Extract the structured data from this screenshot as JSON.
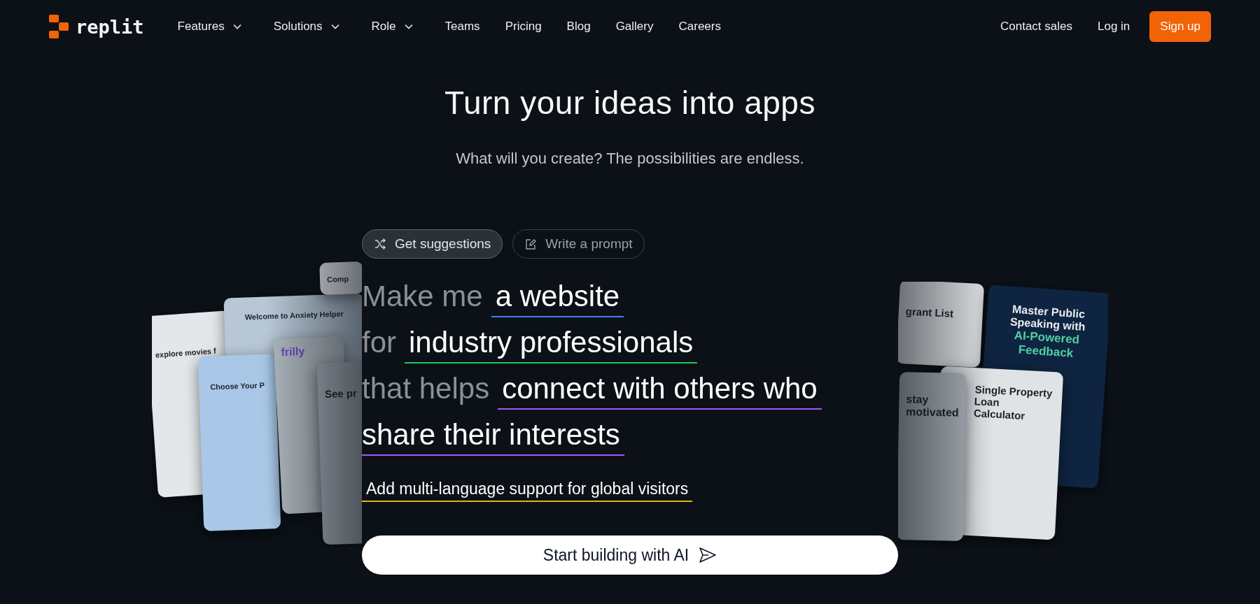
{
  "nav": {
    "logo": "replit",
    "items": [
      {
        "label": "Features",
        "menu": true
      },
      {
        "label": "Solutions",
        "menu": true
      },
      {
        "label": "Role",
        "menu": true
      },
      {
        "label": "Teams",
        "menu": false
      },
      {
        "label": "Pricing",
        "menu": false
      },
      {
        "label": "Blog",
        "menu": false
      },
      {
        "label": "Gallery",
        "menu": false
      },
      {
        "label": "Careers",
        "menu": false
      }
    ],
    "actions": [
      {
        "label": "Contact sales",
        "kind": "link"
      },
      {
        "label": "Log in",
        "kind": "link"
      },
      {
        "label": "Sign up",
        "kind": "primary"
      }
    ]
  },
  "hero": {
    "title": "Turn your ideas into apps",
    "subtitle": "What will you create? The possibilities are endless."
  },
  "modes": [
    {
      "label": "Get suggestions",
      "selected": true
    },
    {
      "label": "Write a prompt",
      "selected": false
    }
  ],
  "prompt_lines": [
    [
      {
        "kind": "fixed",
        "text": "Make me"
      },
      {
        "kind": "slot",
        "text": "a website",
        "color": "#3b82f6"
      }
    ],
    [
      {
        "kind": "fixed",
        "text": "for"
      },
      {
        "kind": "slot",
        "text": "industry professionals",
        "color": "#22c55e"
      }
    ],
    [
      {
        "kind": "fixed",
        "text": "that helps"
      },
      {
        "kind": "slot",
        "text": "connect with others who",
        "color": "#a855f7"
      }
    ],
    [
      {
        "kind": "slot",
        "text": "share their interests",
        "color": "#a855f7"
      }
    ]
  ],
  "suggestion": {
    "text": "Add multi-language support for global visitors",
    "color": "#eab308"
  },
  "cta": {
    "label": "Start building with AI"
  },
  "showcase_left": [
    {
      "title": "explore movies f"
    },
    {
      "title": "Welcome to Anxiety Helper"
    },
    {
      "title": "Comp"
    },
    {
      "title": "Choose Your P"
    },
    {
      "title": "frilly"
    },
    {
      "title": "See pr"
    }
  ],
  "showcase_right": [
    {
      "title": "grant List"
    },
    {
      "title": "Master Public Speaking with",
      "accent": "AI-Powered Feedback"
    },
    {
      "title": "Single Property Loan Calculator"
    },
    {
      "title": "stay motivated"
    }
  ]
}
